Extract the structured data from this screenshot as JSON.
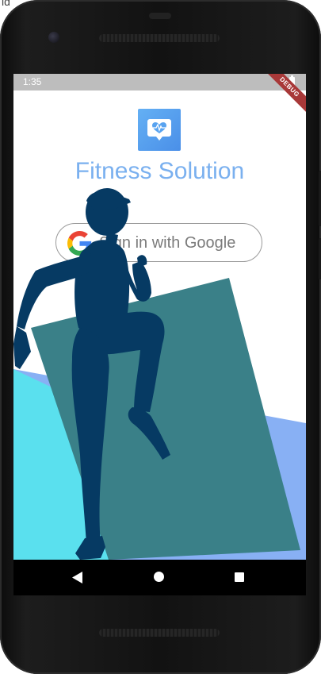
{
  "corner": {
    "text": "id"
  },
  "status_bar": {
    "time": "1:35",
    "battery_icon": "battery-icon"
  },
  "debug_banner": {
    "label": "DEBUG"
  },
  "app": {
    "logo_icon": "heart-chat-icon",
    "title": "Fitness Solution",
    "signin_label": "Sign in with Google",
    "signin_icon": "google-g-icon",
    "brand_color": "#7ab0ef",
    "background_shapes": [
      "#5ae0ee",
      "#3a8088",
      "#88b0f4"
    ],
    "silhouette_color": "#063a63"
  },
  "navigation": {
    "back_icon": "back-triangle-icon",
    "home_icon": "home-circle-icon",
    "recents_icon": "recents-square-icon"
  }
}
